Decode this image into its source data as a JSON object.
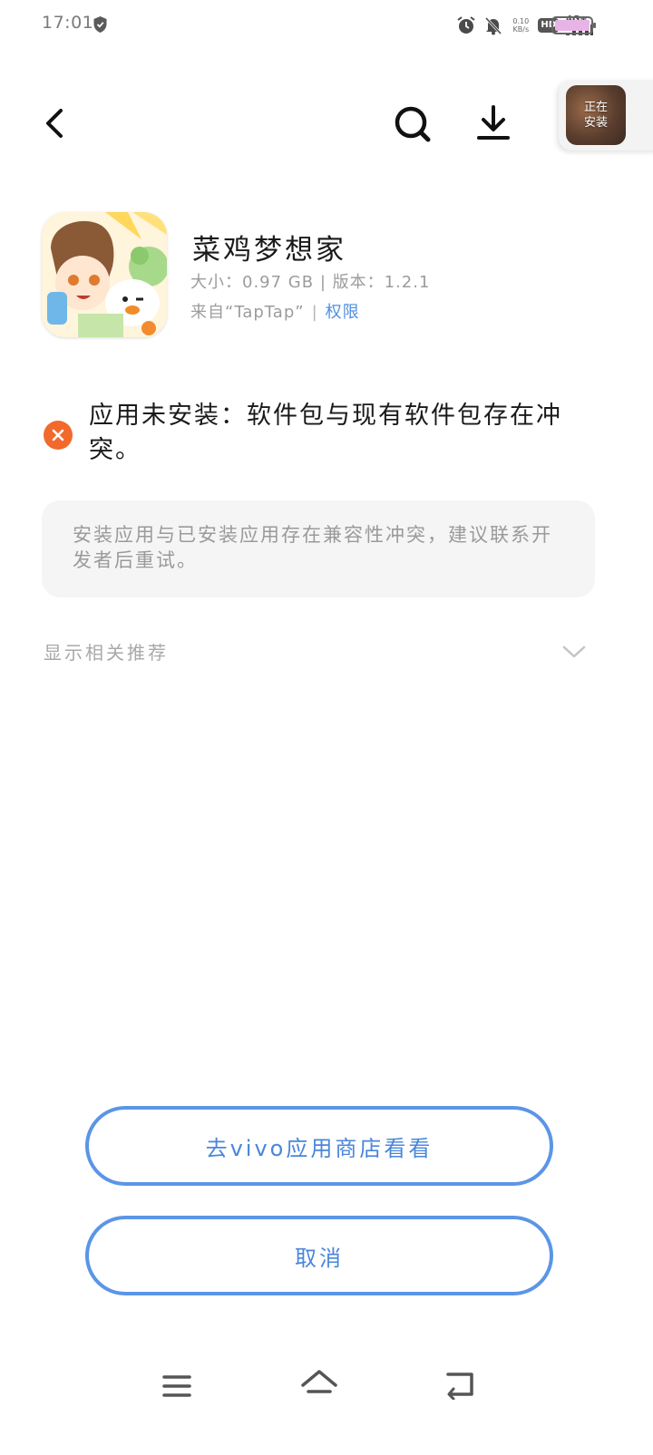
{
  "status_bar": {
    "time": "17:01",
    "net_speed_value": "0.10",
    "net_speed_unit": "KB/s",
    "hd_label": "HD",
    "network_type": "4G+",
    "icons": [
      "shield-icon",
      "alarm-icon",
      "mute-bell-icon",
      "signal-icon",
      "battery-icon"
    ],
    "battery_color": "#e8b4e6"
  },
  "nav": {
    "icons": [
      "back-icon",
      "search-icon",
      "download-icon"
    ],
    "installing_label": "正在安装"
  },
  "app": {
    "name": "菜鸡梦想家",
    "meta": "大小：0.97 GB | 版本：1.2.1",
    "source": "来自“TapTap”",
    "permission_link": "权限"
  },
  "error": {
    "message": "应用未安装：软件包与现有软件包存在冲突。",
    "icon_color": "#f2692c"
  },
  "hint": {
    "text": "安装应用与已安装应用存在兼容性冲突，建议联系开发者后重试。"
  },
  "related": {
    "label": "显示相关推荐"
  },
  "buttons": {
    "store_label": "去vivo应用商店看看",
    "cancel_label": "取消",
    "accent_color": "#5b95e6"
  },
  "system_nav": {
    "icons": [
      "menu-icon",
      "home-icon",
      "return-icon"
    ]
  }
}
